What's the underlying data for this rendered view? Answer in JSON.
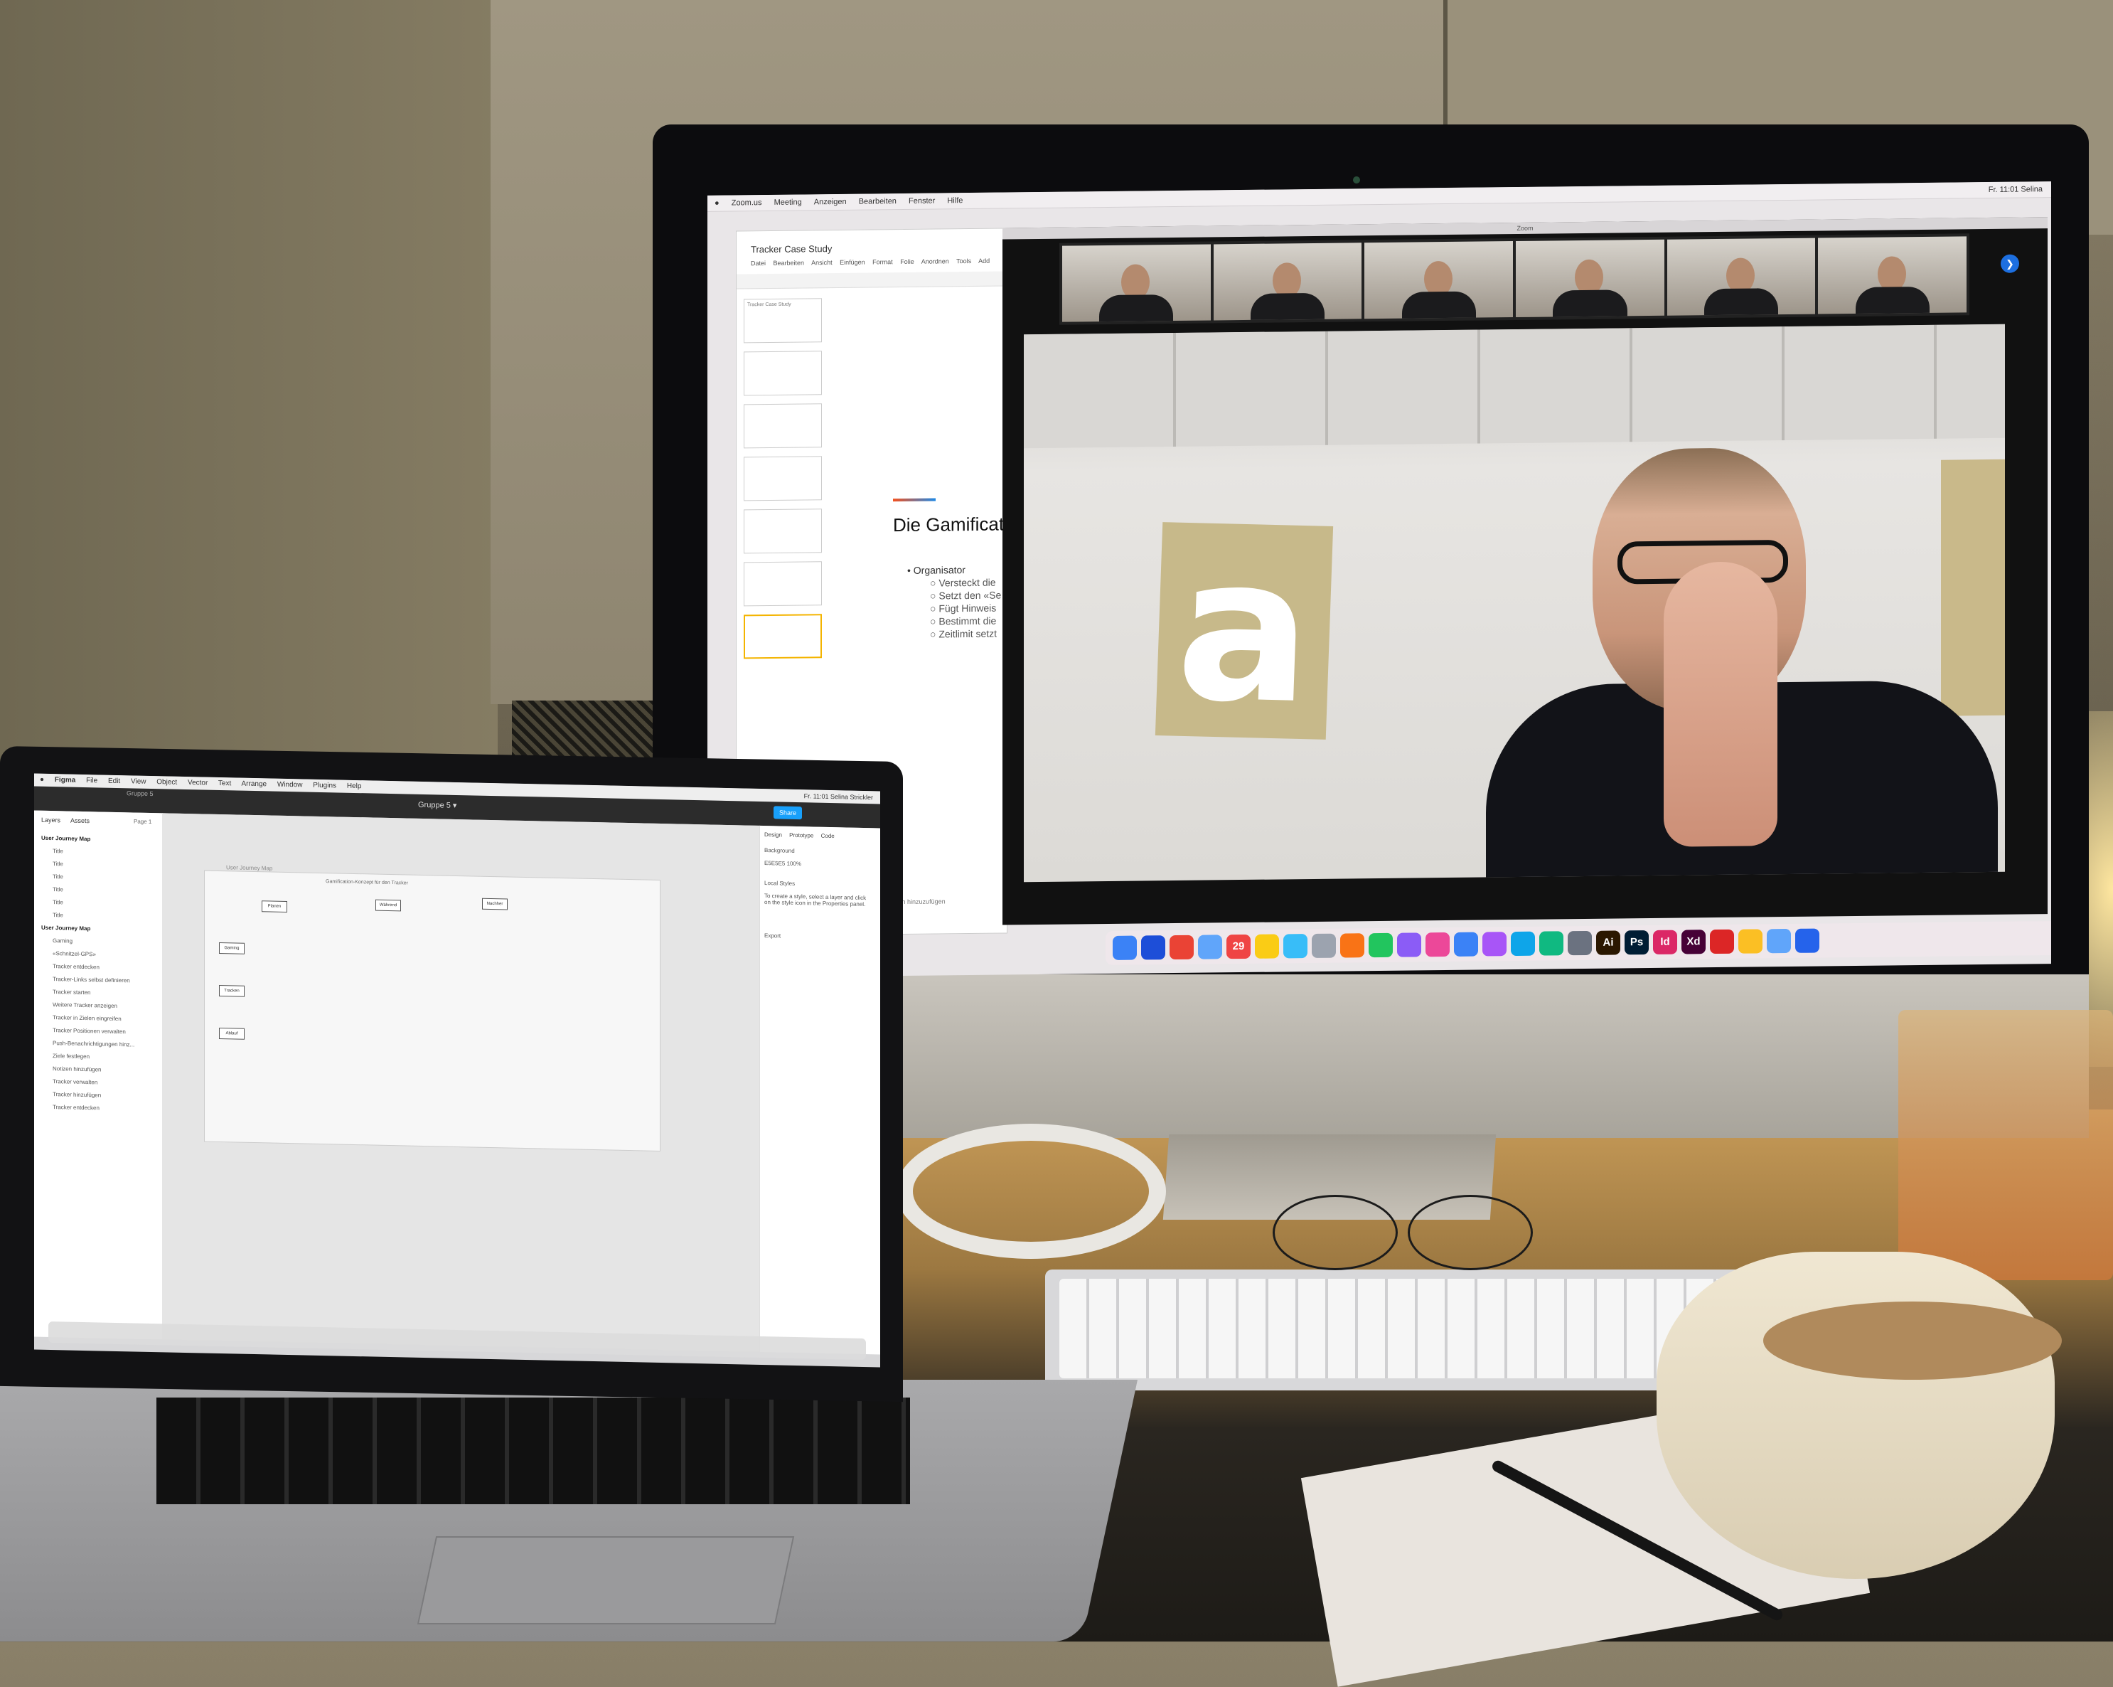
{
  "imac": {
    "menubar": [
      "Zoom.us",
      "Meeting",
      "Anzeigen",
      "Bearbeiten",
      "Fenster",
      "Hilfe"
    ],
    "status": "Fr. 11:01  Selina",
    "apple_logo": "",
    "slides": {
      "doc_title": "Tracker Case Study",
      "menu": [
        "Datei",
        "Bearbeiten",
        "Ansicht",
        "Einfügen",
        "Format",
        "Folie",
        "Anordnen",
        "Tools",
        "Add"
      ],
      "thumbnail_title": "Tracker Case Study",
      "heading": "Die Gamificat",
      "bullet": "Organisator",
      "sub_bullets": [
        "Versteckt die",
        "Setzt den «Se",
        "Fügt Hinweis",
        "Bestimmt die",
        "Zeitlimit setzt"
      ],
      "notes": "um Vortragsnotizen hinzuzufügen"
    },
    "zoom": {
      "window_title": "Zoom",
      "participant_count": 6,
      "speaker_poster_letter": "a"
    },
    "dock_icons": [
      {
        "label": "",
        "color": "#3b82f6"
      },
      {
        "label": "",
        "color": "#1d4ed8"
      },
      {
        "label": "",
        "color": "#ea4335"
      },
      {
        "label": "",
        "color": "#60a5fa"
      },
      {
        "label": "29",
        "color": "#ef4444"
      },
      {
        "label": "",
        "color": "#facc15"
      },
      {
        "label": "",
        "color": "#38bdf8"
      },
      {
        "label": "",
        "color": "#9ca3af"
      },
      {
        "label": "",
        "color": "#f97316"
      },
      {
        "label": "",
        "color": "#22c55e"
      },
      {
        "label": "",
        "color": "#8b5cf6"
      },
      {
        "label": "",
        "color": "#ec4899"
      },
      {
        "label": "",
        "color": "#3b82f6"
      },
      {
        "label": "",
        "color": "#a855f7"
      },
      {
        "label": "",
        "color": "#0ea5e9"
      },
      {
        "label": "",
        "color": "#10b981"
      },
      {
        "label": "",
        "color": "#6b7280"
      },
      {
        "label": "Ai",
        "color": "#2b1700"
      },
      {
        "label": "Ps",
        "color": "#001d34"
      },
      {
        "label": "Id",
        "color": "#db2766"
      },
      {
        "label": "Xd",
        "color": "#470137"
      },
      {
        "label": "",
        "color": "#dc2626"
      },
      {
        "label": "",
        "color": "#fbbf24"
      },
      {
        "label": "",
        "color": "#60a5fa"
      },
      {
        "label": "",
        "color": "#2563eb"
      }
    ]
  },
  "macbook": {
    "menubar": [
      "Figma",
      "File",
      "Edit",
      "View",
      "Object",
      "Vector",
      "Text",
      "Arrange",
      "Window",
      "Plugins",
      "Help"
    ],
    "status": "Fr. 11:01  Selina Strickler",
    "figma_file": "Gruppe 5 ▾",
    "breadcrumb": "Gruppe 5",
    "share": "Share",
    "layers_tabs": [
      "Layers",
      "Assets"
    ],
    "page": "Page 1",
    "layers": [
      {
        "label": "User Journey Map",
        "top": true
      },
      {
        "label": "Title",
        "top": false
      },
      {
        "label": "Title",
        "top": false
      },
      {
        "label": "Title",
        "top": false
      },
      {
        "label": "Title",
        "top": false
      },
      {
        "label": "Title",
        "top": false
      },
      {
        "label": "Title",
        "top": false
      },
      {
        "label": "User Journey Map",
        "top": true
      },
      {
        "label": "Gaming",
        "top": false
      },
      {
        "label": "«Schnitzel-GPS»",
        "top": false
      },
      {
        "label": "Tracker entdecken",
        "top": false
      },
      {
        "label": "Tracker-Links selbst definieren",
        "top": false
      },
      {
        "label": "Tracker starten",
        "top": false
      },
      {
        "label": "Weitere Tracker anzeigen",
        "top": false
      },
      {
        "label": "Tracker in Zielen eingreifen",
        "top": false
      },
      {
        "label": "Tracker Positionen verwalten",
        "top": false
      },
      {
        "label": "Push-Benachrichtigungen hinz...",
        "top": false
      },
      {
        "label": "Ziele festlegen",
        "top": false
      },
      {
        "label": "Notizen hinzufügen",
        "top": false
      },
      {
        "label": "Tracker verwalten",
        "top": false
      },
      {
        "label": "Tracker hinzufügen",
        "top": false
      },
      {
        "label": "Tracker entdecken",
        "top": false
      }
    ],
    "frame_label": "User Journey Map",
    "frame_title": "Gamification-Konzept für den Tracker",
    "journey_boxes": [
      "Planen",
      "Während",
      "Nachher",
      "Gaming",
      "Tracken",
      "Ablauf"
    ],
    "design_tabs": [
      "Design",
      "Prototype",
      "Code"
    ],
    "design_rows": [
      "Background",
      "E5E5E5  100%",
      "Local Styles",
      "To create a style, select a layer and click on the style icon in the Properties panel.",
      "Export"
    ]
  }
}
